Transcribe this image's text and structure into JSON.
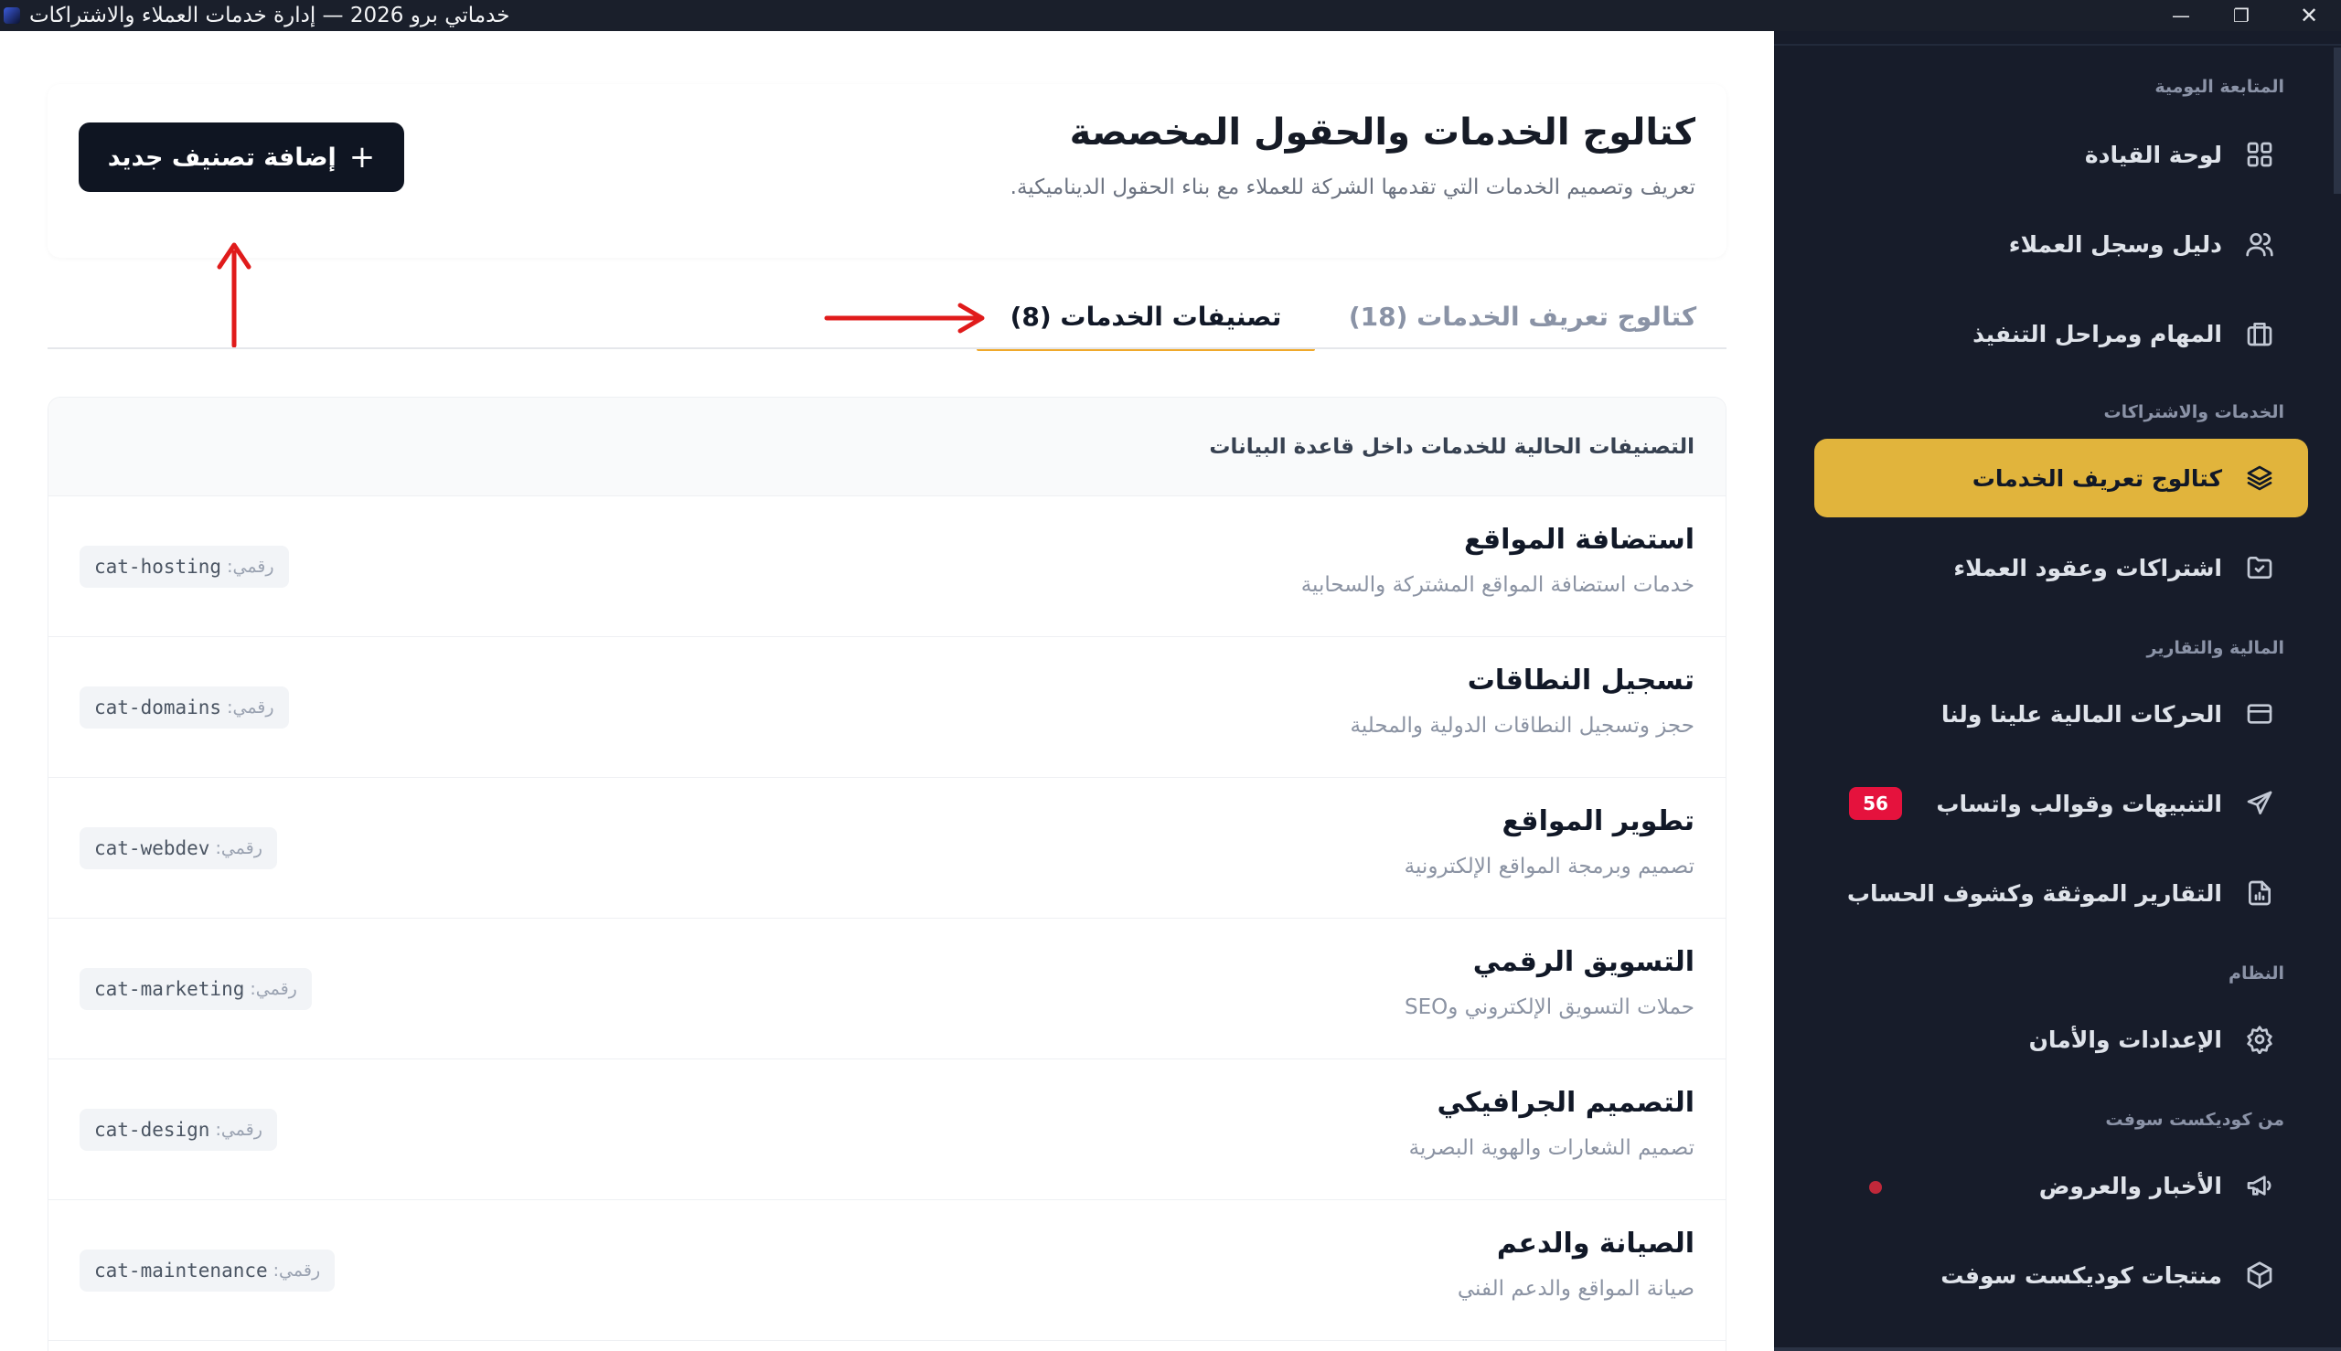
{
  "window": {
    "title": "خدماتي برو 2026 — إدارة خدمات العملاء والاشتراكات",
    "minimize": "—",
    "maximize": "❐",
    "close": "✕"
  },
  "sidebar": {
    "sections": [
      {
        "label": "المتابعة اليومية",
        "items": [
          {
            "label": "لوحة القيادة",
            "icon": "grid-icon"
          },
          {
            "label": "دليل وسجل العملاء",
            "icon": "users-icon"
          },
          {
            "label": "المهام ومراحل التنفيذ",
            "icon": "briefcase-icon"
          }
        ]
      },
      {
        "label": "الخدمات والاشتراكات",
        "items": [
          {
            "label": "كتالوج تعريف الخدمات",
            "icon": "layers-icon",
            "active": true
          },
          {
            "label": "اشتراكات وعقود العملاء",
            "icon": "folder-check-icon"
          }
        ]
      },
      {
        "label": "المالية والتقارير",
        "items": [
          {
            "label": "الحركات المالية علينا ولنا",
            "icon": "credit-card-icon"
          },
          {
            "label": "التنبيهات وقوالب واتساب",
            "icon": "send-icon",
            "badge": "56"
          },
          {
            "label": "التقارير الموثقة وكشوف الحساب",
            "icon": "file-chart-icon"
          }
        ]
      },
      {
        "label": "النظام",
        "items": [
          {
            "label": "الإعدادات والأمان",
            "icon": "gear-icon"
          }
        ]
      },
      {
        "label": "من كوديكست سوفت",
        "items": [
          {
            "label": "الأخبار والعروض",
            "icon": "megaphone-icon"
          },
          {
            "label": "منتجات كوديكست سوفت",
            "icon": "package-icon"
          }
        ]
      }
    ],
    "accent_color": "#e1b43c",
    "badge_color": "#e5123d"
  },
  "header": {
    "title": "كتالوج الخدمات والحقول المخصصة",
    "subtitle": "تعريف وتصميم الخدمات التي تقدمها الشركة للعملاء مع بناء الحقول الديناميكية.",
    "add_button_label": "إضافة تصنيف جديد",
    "add_button_icon": "+"
  },
  "tabs": [
    {
      "label": "كتالوج تعريف الخدمات (18)",
      "active": false
    },
    {
      "label": "تصنيفات الخدمات (8)",
      "active": true
    }
  ],
  "list": {
    "heading": "التصنيفات الحالية للخدمات داخل قاعدة البيانات",
    "id_label": "رقمي:",
    "rows": [
      {
        "name": "استضافة المواقع",
        "desc": "خدمات استضافة المواقع المشتركة والسحابية",
        "code": "cat-hosting"
      },
      {
        "name": "تسجيل النطاقات",
        "desc": "حجز وتسجيل النطاقات الدولية والمحلية",
        "code": "cat-domains"
      },
      {
        "name": "تطوير المواقع",
        "desc": "تصميم وبرمجة المواقع الإلكترونية",
        "code": "cat-webdev"
      },
      {
        "name": "التسويق الرقمي",
        "desc": "حملات التسويق الإلكتروني وSEO",
        "code": "cat-marketing"
      },
      {
        "name": "التصميم الجرافيكي",
        "desc": "تصميم الشعارات والهوية البصرية",
        "code": "cat-design"
      },
      {
        "name": "الصيانة والدعم",
        "desc": "صيانة المواقع والدعم الفني",
        "code": "cat-maintenance"
      }
    ]
  }
}
